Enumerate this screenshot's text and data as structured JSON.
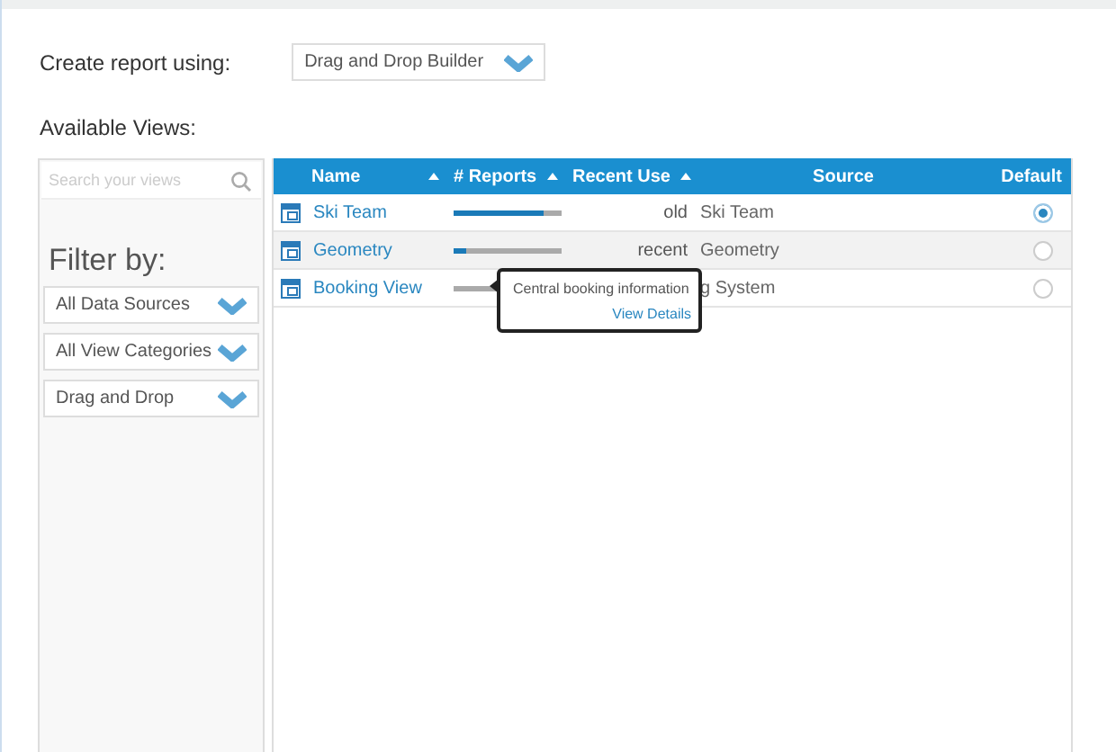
{
  "create_report": {
    "label": "Create report using:",
    "value": "Drag and Drop Builder"
  },
  "available_views_label": "Available Views:",
  "sidebar": {
    "search_placeholder": "Search your views",
    "filter_title": "Filter by:",
    "filters": [
      {
        "value": "All Data Sources"
      },
      {
        "value": "All View Categories"
      },
      {
        "value": "Drag and Drop"
      }
    ]
  },
  "table": {
    "columns": [
      {
        "label": "Name",
        "sortable": true
      },
      {
        "label": "# Reports",
        "sortable": true
      },
      {
        "label": "Recent Use",
        "sortable": true
      },
      {
        "label": "Source",
        "sortable": false
      },
      {
        "label": "Default",
        "sortable": false
      }
    ],
    "rows": [
      {
        "name": "Ski Team",
        "level": 0.83,
        "recent_use": "old",
        "source": "Ski Team",
        "selected": true
      },
      {
        "name": "Geometry",
        "level": 0.12,
        "recent_use": "recent",
        "source": "Geometry",
        "selected": false
      },
      {
        "name": "Booking View",
        "source": "g System",
        "selected": false,
        "tooltip": {
          "text": "Central booking information",
          "link": "View Details"
        }
      }
    ]
  }
}
